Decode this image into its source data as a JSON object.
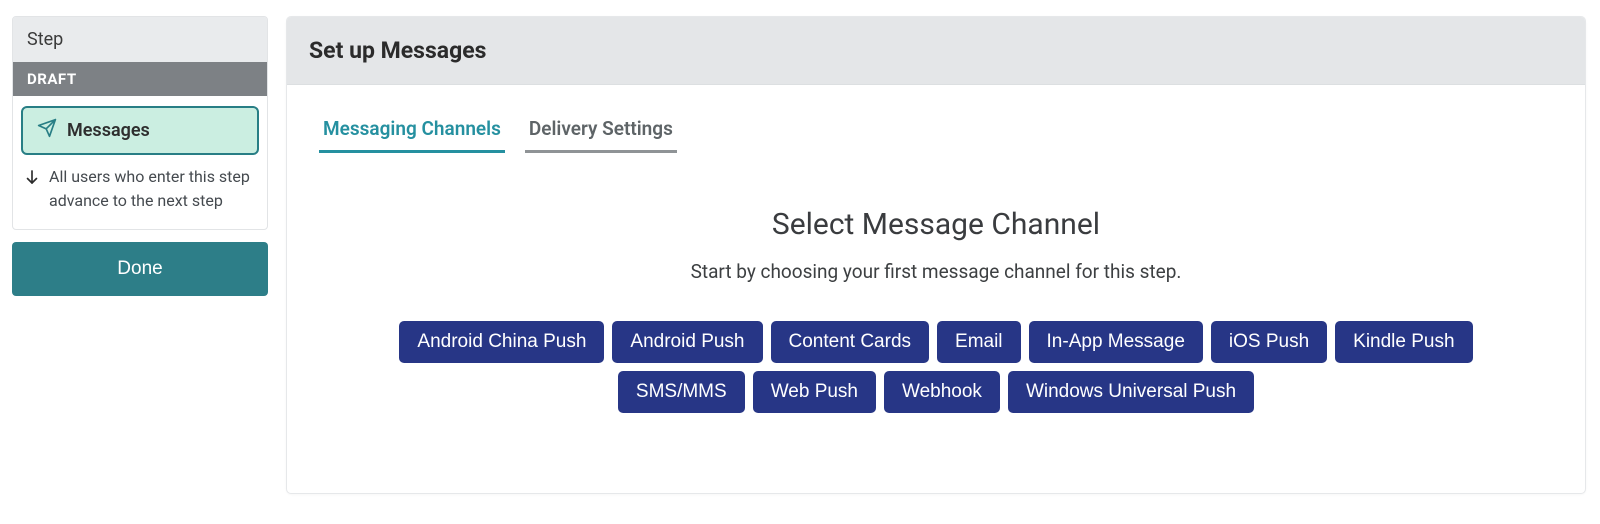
{
  "sidebar": {
    "step_label": "Step",
    "draft_label": "DRAFT",
    "messages_pill": "Messages",
    "advance_text": "All users who enter this step advance to the next step",
    "done_label": "Done"
  },
  "main": {
    "header_title": "Set up Messages",
    "tabs": [
      {
        "label": "Messaging Channels",
        "active": true
      },
      {
        "label": "Delivery Settings",
        "active": false
      }
    ],
    "select_title": "Select Message Channel",
    "select_subtitle": "Start by choosing your first message channel for this step.",
    "channels": [
      "Android China Push",
      "Android Push",
      "Content Cards",
      "Email",
      "In-App Message",
      "iOS Push",
      "Kindle Push",
      "SMS/MMS",
      "Web Push",
      "Webhook",
      "Windows Universal Push"
    ]
  }
}
